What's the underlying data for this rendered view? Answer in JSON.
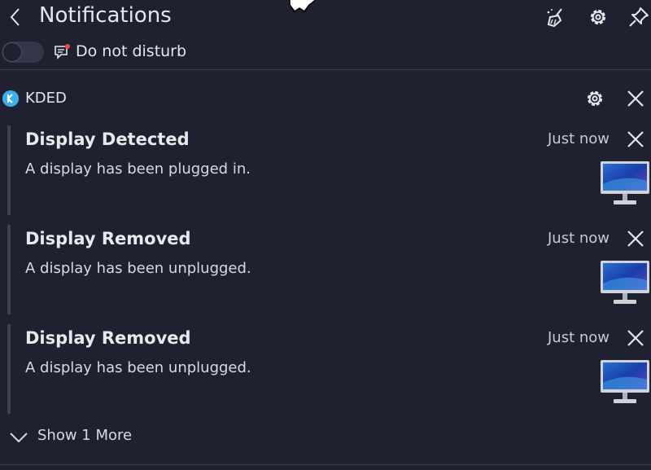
{
  "header": {
    "title": "Notifications",
    "icons": [
      "back-chevron-icon",
      "clear-all-broom-icon",
      "settings-gear-icon",
      "pin-icon"
    ]
  },
  "dnd": {
    "label": "Do not disturb",
    "enabled": false,
    "icon": "do-not-disturb-icon"
  },
  "group": {
    "app_name": "KDED",
    "app_icon": "kde-logo-icon",
    "notifications": [
      {
        "title": "Display Detected",
        "body": "A display has been plugged in.",
        "time": "Just now",
        "icon": "monitor-icon"
      },
      {
        "title": "Display Removed",
        "body": "A display has been unplugged.",
        "time": "Just now",
        "icon": "monitor-icon"
      },
      {
        "title": "Display Removed",
        "body": "A display has been unplugged.",
        "time": "Just now",
        "icon": "monitor-icon"
      }
    ],
    "show_more_label": "Show 1 More"
  },
  "colors": {
    "background": "#1f2130",
    "accent": "#3daee9",
    "text": "#e6e7ea"
  }
}
